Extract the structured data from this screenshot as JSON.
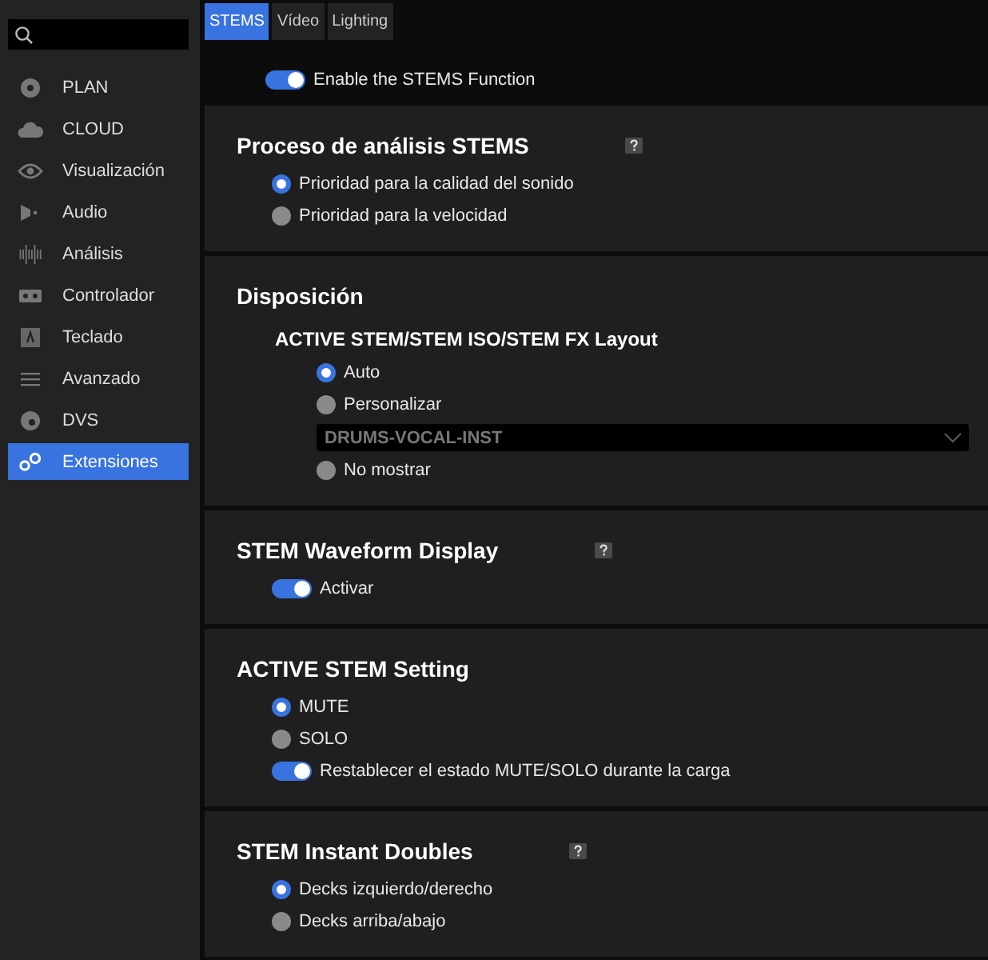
{
  "sidebar": {
    "items": [
      {
        "label": "PLAN",
        "selected": false
      },
      {
        "label": "CLOUD",
        "selected": false
      },
      {
        "label": "Visualización",
        "selected": false
      },
      {
        "label": "Audio",
        "selected": false
      },
      {
        "label": "Análisis",
        "selected": false
      },
      {
        "label": "Controlador",
        "selected": false
      },
      {
        "label": "Teclado",
        "selected": false
      },
      {
        "label": "Avanzado",
        "selected": false
      },
      {
        "label": "DVS",
        "selected": false
      },
      {
        "label": "Extensiones",
        "selected": true
      }
    ]
  },
  "tabs": [
    {
      "label": "STEMS",
      "selected": true
    },
    {
      "label": "Vídeo",
      "selected": false
    },
    {
      "label": "Lighting",
      "selected": false
    }
  ],
  "master_toggle": {
    "label": "Enable the STEMS Function",
    "on": true
  },
  "sections": [
    {
      "title": "Proceso de análisis STEMS",
      "help": true,
      "rows": [
        {
          "kind": "radio",
          "label": "Prioridad para la calidad del sonido",
          "selected": true
        },
        {
          "kind": "radio",
          "label": "Prioridad para la velocidad",
          "selected": false
        }
      ]
    },
    {
      "title": "Disposición",
      "help": false,
      "rows": [
        {
          "kind": "subheading",
          "label": "ACTIVE STEM/STEM ISO/STEM FX Layout"
        },
        {
          "kind": "radio",
          "indent": true,
          "label": "Auto",
          "selected": true
        },
        {
          "kind": "radio",
          "indent": true,
          "label": "Personalizar",
          "selected": false
        },
        {
          "kind": "select",
          "indent": true,
          "value": "DRUMS-VOCAL-INST",
          "disabled": true
        },
        {
          "kind": "radio",
          "indent": true,
          "label": "No mostrar",
          "selected": false
        }
      ]
    },
    {
      "title": "STEM Waveform Display",
      "help": true,
      "rows": [
        {
          "kind": "toggle",
          "label": "Activar",
          "on": true
        }
      ]
    },
    {
      "title": "ACTIVE STEM Setting",
      "help": false,
      "rows": [
        {
          "kind": "radio",
          "label": "MUTE",
          "selected": true
        },
        {
          "kind": "radio",
          "label": "SOLO",
          "selected": false
        },
        {
          "kind": "toggle",
          "label": "Restablecer el estado MUTE/SOLO durante la carga",
          "on": true
        }
      ]
    },
    {
      "title": "STEM Instant Doubles",
      "help": true,
      "rows": [
        {
          "kind": "radio",
          "label": "Decks izquierdo/derecho",
          "selected": true
        },
        {
          "kind": "radio",
          "label": "Decks arriba/abajo",
          "selected": false
        }
      ]
    }
  ]
}
